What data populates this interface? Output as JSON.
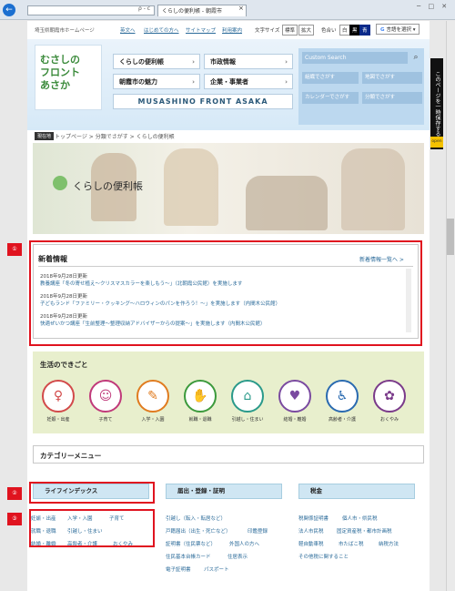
{
  "browser": {
    "address": "",
    "tab_title": "くらしの便利帳 - 朝霞市",
    "tab_close": "×",
    "window_controls": "─ □ ✕",
    "addr_controls": "ρ - c",
    "back_glyph": "←"
  },
  "header": {
    "site_subtitle": "埼玉県朝霞市ホームページ",
    "links": [
      "英文へ",
      "はじめての方へ",
      "サイトマップ",
      "利用案内"
    ],
    "font_size_label": "文字サイズ",
    "font_size_options": [
      "標準",
      "拡大"
    ],
    "color_label": "色合い",
    "color_options": [
      "白",
      "黒",
      "青"
    ],
    "lang_select": "言語を選択"
  },
  "logo": {
    "line1": "むさしの",
    "line2": "フロント",
    "line3": "あさか"
  },
  "main_menu": [
    "くらしの便利帳",
    "市政情報",
    "朝霞市の魅力",
    "企業・事業者"
  ],
  "brand_strip": "MUSASHINO FRONT ASAKA",
  "search": {
    "placeholder": "Custom Search",
    "icon": "search-icon",
    "buttons": [
      "組織でさがす",
      "地図でさがす",
      "カレンダーでさがす",
      "分類でさがす"
    ]
  },
  "side_tab": {
    "label": "このページを一時保存する",
    "open": "open"
  },
  "breadcrumb": {
    "tag": "現在地",
    "path": "トップページ > 分類でさがす > くらしの便利帳"
  },
  "hero": {
    "title": "くらしの便利帳"
  },
  "news": {
    "title": "新着情報",
    "all_link": "新着情報一覧へ >",
    "items": [
      {
        "date": "2018年9月28日更新",
        "text": "教養講座「冬の寄せ植え～クリスマスカラーを楽しもう～」（北朝霞公民館）を実施します"
      },
      {
        "date": "2018年9月28日更新",
        "text": "子どもランド「ファミリー・クッキング～ハロウィンのパンを作ろう！～」を実施します（内間木公民館）"
      },
      {
        "date": "2018年9月28日更新",
        "text": "快適ぜいかつ講座「生前整理～整理収納アドバイザーからの提案～」を実施します（内間木公民館）"
      }
    ]
  },
  "annotations": [
    "①",
    "②",
    "③"
  ],
  "life": {
    "title": "生活のできごと",
    "items": [
      {
        "label": "妊娠・出産",
        "icon": "pregnancy-icon",
        "glyph": "♀"
      },
      {
        "label": "子育て",
        "icon": "childcare-icon",
        "glyph": "☺"
      },
      {
        "label": "入学・入園",
        "icon": "school-icon",
        "glyph": "✎"
      },
      {
        "label": "就職・退職",
        "icon": "job-icon",
        "glyph": "✋"
      },
      {
        "label": "引越し・住まい",
        "icon": "moving-icon",
        "glyph": "⌂"
      },
      {
        "label": "結婚・離婚",
        "icon": "marriage-icon",
        "glyph": "♥"
      },
      {
        "label": "高齢者・介護",
        "icon": "elderly-icon",
        "glyph": "♿"
      },
      {
        "label": "おくやみ",
        "icon": "condolence-icon",
        "glyph": "✿"
      }
    ]
  },
  "category": {
    "title": "カテゴリーメニュー",
    "columns": [
      {
        "head": "ライフインデックス",
        "links": [
          "妊娠・出産",
          "入学・入園",
          "子育て",
          "就職・退職",
          "引越し・住まい",
          "結婚・離婚",
          "高齢者・介護",
          "おくやみ"
        ]
      },
      {
        "head": "届出・登録・証明",
        "links": [
          "引越し（転入・転居など）",
          "戸籍届出（出生・死亡など）",
          "印鑑登録",
          "証明書（住民票など）",
          "外国人の方へ",
          "住民基本台帳カード",
          "住居表示",
          "電子証明書",
          "パスポート"
        ]
      },
      {
        "head": "税金",
        "links": [
          "税関係証明書",
          "個人市・県民税",
          "法人市民税",
          "固定資産税・都市計画税",
          "軽自動車税",
          "市たばこ税",
          "納税方法",
          "その他税に関すること"
        ]
      }
    ]
  },
  "colors": {
    "accent": "#2a6a99",
    "annotation": "#e0131f",
    "life_bg": "#e8efcd",
    "cat_head": "#cfe6f3"
  }
}
